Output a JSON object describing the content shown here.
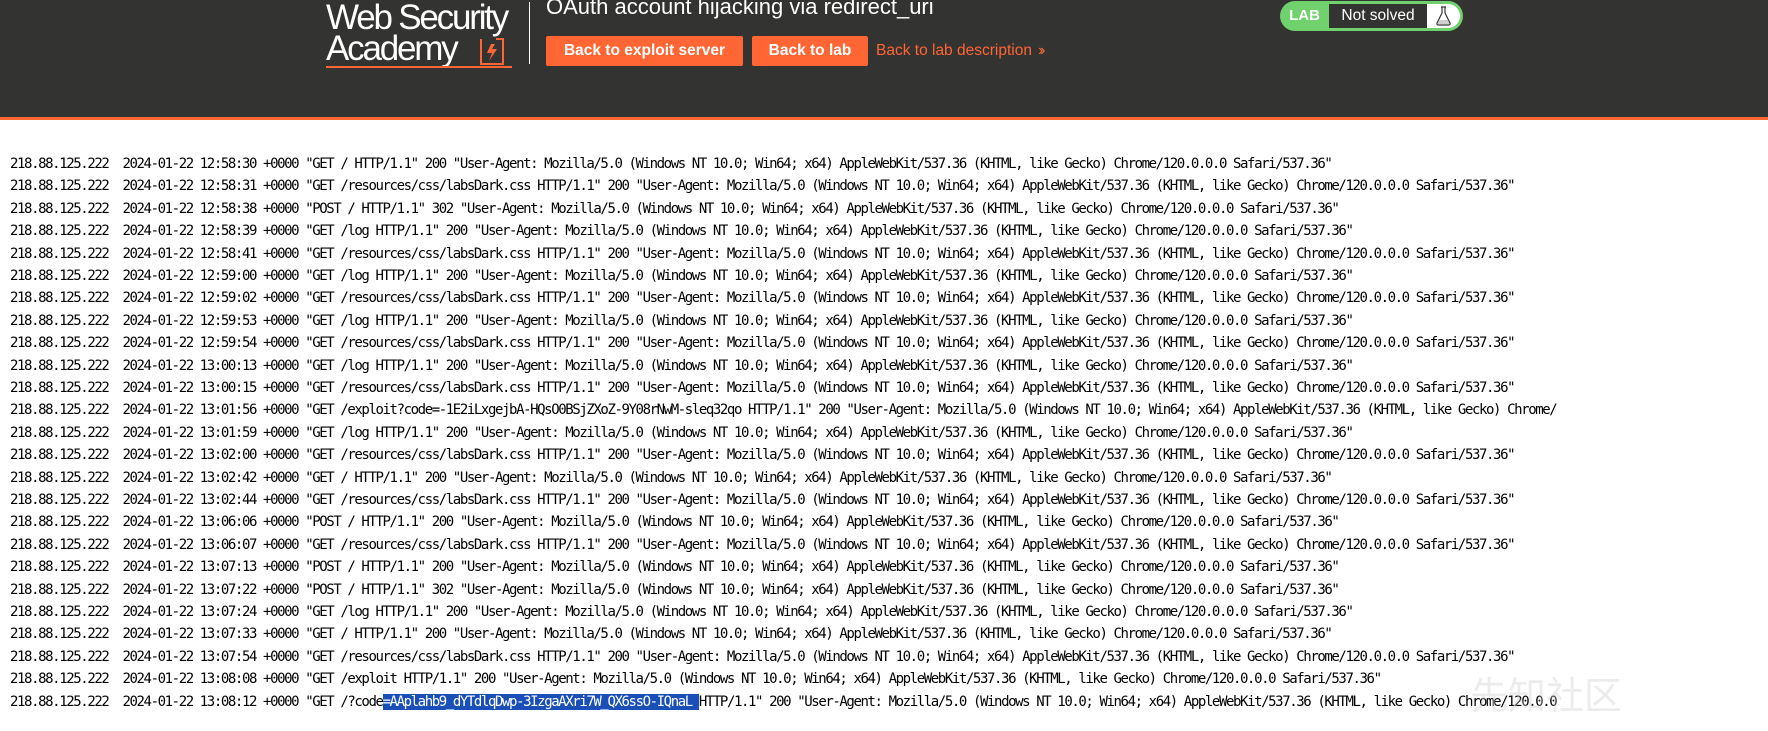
{
  "header": {
    "logo_line1": "Web Security",
    "logo_line2": "Academy",
    "lab_title": "OAuth account hijacking via redirect_uri",
    "buttons": {
      "exploit_server": "Back to exploit server",
      "lab": "Back to lab"
    },
    "description_link": "Back to lab description",
    "status": {
      "label": "LAB",
      "text": "Not solved"
    },
    "colors": {
      "background": "#333332",
      "accent": "#ff6633",
      "status_green": "#70d16d"
    }
  },
  "log": {
    "lines": [
      {
        "text": "218.88.125.222  2024-01-22 12:58:30 +0000 \"GET / HTTP/1.1\" 200 \"User-Agent: Mozilla/5.0 (Windows NT 10.0; Win64; x64) AppleWebKit/537.36 (KHTML, like Gecko) Chrome/120.0.0.0 Safari/537.36\""
      },
      {
        "text": "218.88.125.222  2024-01-22 12:58:31 +0000 \"GET /resources/css/labsDark.css HTTP/1.1\" 200 \"User-Agent: Mozilla/5.0 (Windows NT 10.0; Win64; x64) AppleWebKit/537.36 (KHTML, like Gecko) Chrome/120.0.0.0 Safari/537.36\""
      },
      {
        "text": "218.88.125.222  2024-01-22 12:58:38 +0000 \"POST / HTTP/1.1\" 302 \"User-Agent: Mozilla/5.0 (Windows NT 10.0; Win64; x64) AppleWebKit/537.36 (KHTML, like Gecko) Chrome/120.0.0.0 Safari/537.36\""
      },
      {
        "text": "218.88.125.222  2024-01-22 12:58:39 +0000 \"GET /log HTTP/1.1\" 200 \"User-Agent: Mozilla/5.0 (Windows NT 10.0; Win64; x64) AppleWebKit/537.36 (KHTML, like Gecko) Chrome/120.0.0.0 Safari/537.36\""
      },
      {
        "text": "218.88.125.222  2024-01-22 12:58:41 +0000 \"GET /resources/css/labsDark.css HTTP/1.1\" 200 \"User-Agent: Mozilla/5.0 (Windows NT 10.0; Win64; x64) AppleWebKit/537.36 (KHTML, like Gecko) Chrome/120.0.0.0 Safari/537.36\""
      },
      {
        "text": "218.88.125.222  2024-01-22 12:59:00 +0000 \"GET /log HTTP/1.1\" 200 \"User-Agent: Mozilla/5.0 (Windows NT 10.0; Win64; x64) AppleWebKit/537.36 (KHTML, like Gecko) Chrome/120.0.0.0 Safari/537.36\""
      },
      {
        "text": "218.88.125.222  2024-01-22 12:59:02 +0000 \"GET /resources/css/labsDark.css HTTP/1.1\" 200 \"User-Agent: Mozilla/5.0 (Windows NT 10.0; Win64; x64) AppleWebKit/537.36 (KHTML, like Gecko) Chrome/120.0.0.0 Safari/537.36\""
      },
      {
        "text": "218.88.125.222  2024-01-22 12:59:53 +0000 \"GET /log HTTP/1.1\" 200 \"User-Agent: Mozilla/5.0 (Windows NT 10.0; Win64; x64) AppleWebKit/537.36 (KHTML, like Gecko) Chrome/120.0.0.0 Safari/537.36\""
      },
      {
        "text": "218.88.125.222  2024-01-22 12:59:54 +0000 \"GET /resources/css/labsDark.css HTTP/1.1\" 200 \"User-Agent: Mozilla/5.0 (Windows NT 10.0; Win64; x64) AppleWebKit/537.36 (KHTML, like Gecko) Chrome/120.0.0.0 Safari/537.36\""
      },
      {
        "text": "218.88.125.222  2024-01-22 13:00:13 +0000 \"GET /log HTTP/1.1\" 200 \"User-Agent: Mozilla/5.0 (Windows NT 10.0; Win64; x64) AppleWebKit/537.36 (KHTML, like Gecko) Chrome/120.0.0.0 Safari/537.36\""
      },
      {
        "text": "218.88.125.222  2024-01-22 13:00:15 +0000 \"GET /resources/css/labsDark.css HTTP/1.1\" 200 \"User-Agent: Mozilla/5.0 (Windows NT 10.0; Win64; x64) AppleWebKit/537.36 (KHTML, like Gecko) Chrome/120.0.0.0 Safari/537.36\""
      },
      {
        "text": "218.88.125.222  2024-01-22 13:01:56 +0000 \"GET /exploit?code=-1E2iLxgejbA-HQsO0BSjZXoZ-9Y08rNwM-sleq32qo HTTP/1.1\" 200 \"User-Agent: Mozilla/5.0 (Windows NT 10.0; Win64; x64) AppleWebKit/537.36 (KHTML, like Gecko) Chrome/"
      },
      {
        "text": "218.88.125.222  2024-01-22 13:01:59 +0000 \"GET /log HTTP/1.1\" 200 \"User-Agent: Mozilla/5.0 (Windows NT 10.0; Win64; x64) AppleWebKit/537.36 (KHTML, like Gecko) Chrome/120.0.0.0 Safari/537.36\""
      },
      {
        "text": "218.88.125.222  2024-01-22 13:02:00 +0000 \"GET /resources/css/labsDark.css HTTP/1.1\" 200 \"User-Agent: Mozilla/5.0 (Windows NT 10.0; Win64; x64) AppleWebKit/537.36 (KHTML, like Gecko) Chrome/120.0.0.0 Safari/537.36\""
      },
      {
        "text": "218.88.125.222  2024-01-22 13:02:42 +0000 \"GET / HTTP/1.1\" 200 \"User-Agent: Mozilla/5.0 (Windows NT 10.0; Win64; x64) AppleWebKit/537.36 (KHTML, like Gecko) Chrome/120.0.0.0 Safari/537.36\""
      },
      {
        "text": "218.88.125.222  2024-01-22 13:02:44 +0000 \"GET /resources/css/labsDark.css HTTP/1.1\" 200 \"User-Agent: Mozilla/5.0 (Windows NT 10.0; Win64; x64) AppleWebKit/537.36 (KHTML, like Gecko) Chrome/120.0.0.0 Safari/537.36\""
      },
      {
        "text": "218.88.125.222  2024-01-22 13:06:06 +0000 \"POST / HTTP/1.1\" 200 \"User-Agent: Mozilla/5.0 (Windows NT 10.0; Win64; x64) AppleWebKit/537.36 (KHTML, like Gecko) Chrome/120.0.0.0 Safari/537.36\""
      },
      {
        "text": "218.88.125.222  2024-01-22 13:06:07 +0000 \"GET /resources/css/labsDark.css HTTP/1.1\" 200 \"User-Agent: Mozilla/5.0 (Windows NT 10.0; Win64; x64) AppleWebKit/537.36 (KHTML, like Gecko) Chrome/120.0.0.0 Safari/537.36\""
      },
      {
        "text": "218.88.125.222  2024-01-22 13:07:13 +0000 \"POST / HTTP/1.1\" 200 \"User-Agent: Mozilla/5.0 (Windows NT 10.0; Win64; x64) AppleWebKit/537.36 (KHTML, like Gecko) Chrome/120.0.0.0 Safari/537.36\""
      },
      {
        "text": "218.88.125.222  2024-01-22 13:07:22 +0000 \"POST / HTTP/1.1\" 302 \"User-Agent: Mozilla/5.0 (Windows NT 10.0; Win64; x64) AppleWebKit/537.36 (KHTML, like Gecko) Chrome/120.0.0.0 Safari/537.36\""
      },
      {
        "text": "218.88.125.222  2024-01-22 13:07:24 +0000 \"GET /log HTTP/1.1\" 200 \"User-Agent: Mozilla/5.0 (Windows NT 10.0; Win64; x64) AppleWebKit/537.36 (KHTML, like Gecko) Chrome/120.0.0.0 Safari/537.36\""
      },
      {
        "text": "218.88.125.222  2024-01-22 13:07:33 +0000 \"GET / HTTP/1.1\" 200 \"User-Agent: Mozilla/5.0 (Windows NT 10.0; Win64; x64) AppleWebKit/537.36 (KHTML, like Gecko) Chrome/120.0.0.0 Safari/537.36\""
      },
      {
        "text": "218.88.125.222  2024-01-22 13:07:54 +0000 \"GET /resources/css/labsDark.css HTTP/1.1\" 200 \"User-Agent: Mozilla/5.0 (Windows NT 10.0; Win64; x64) AppleWebKit/537.36 (KHTML, like Gecko) Chrome/120.0.0.0 Safari/537.36\""
      },
      {
        "text": "218.88.125.222  2024-01-22 13:08:08 +0000 \"GET /exploit HTTP/1.1\" 200 \"User-Agent: Mozilla/5.0 (Windows NT 10.0; Win64; x64) AppleWebKit/537.36 (KHTML, like Gecko) Chrome/120.0.0.0 Safari/537.36\""
      },
      {
        "text": "218.88.125.222  2024-01-22 13:08:12 +0000 \"GET /?code",
        "highlight": "=AAplahb9_dYTdlqDwp-3IzgaAXri7W_QX6ssO-IQnaL ",
        "after": "HTTP/1.1\" 200 \"User-Agent: Mozilla/5.0 (Windows NT 10.0; Win64; x64) AppleWebKit/537.36 (KHTML, like Gecko) Chrome/120.0.0"
      }
    ]
  },
  "watermark": "先知社区"
}
